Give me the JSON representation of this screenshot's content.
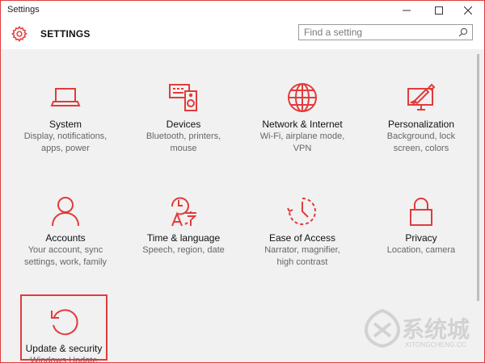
{
  "window": {
    "title": "Settings",
    "accent": "#e23b3b"
  },
  "header": {
    "title": "SETTINGS",
    "search_placeholder": "Find a setting"
  },
  "tiles": [
    {
      "name": "System",
      "desc1": "Display, notifications,",
      "desc2": "apps, power",
      "icon": "laptop-icon"
    },
    {
      "name": "Devices",
      "desc1": "Bluetooth, printers,",
      "desc2": "mouse",
      "icon": "devices-icon"
    },
    {
      "name": "Network & Internet",
      "desc1": "Wi-Fi, airplane mode,",
      "desc2": "VPN",
      "icon": "globe-icon"
    },
    {
      "name": "Personalization",
      "desc1": "Background, lock",
      "desc2": "screen, colors",
      "icon": "paint-icon"
    },
    {
      "name": "Accounts",
      "desc1": "Your account, sync",
      "desc2": "settings, work, family",
      "icon": "person-icon"
    },
    {
      "name": "Time & language",
      "desc1": "Speech, region, date",
      "desc2": "",
      "icon": "time-language-icon"
    },
    {
      "name": "Ease of Access",
      "desc1": "Narrator, magnifier,",
      "desc2": "high contrast",
      "icon": "ease-of-access-icon"
    },
    {
      "name": "Privacy",
      "desc1": "Location, camera",
      "desc2": "",
      "icon": "lock-icon"
    },
    {
      "name": "Update & security",
      "desc1": "Windows Update",
      "desc2": "",
      "icon": "update-icon"
    }
  ],
  "watermark": {
    "text": "系统城",
    "url": "XITONGCHENG.CC"
  }
}
